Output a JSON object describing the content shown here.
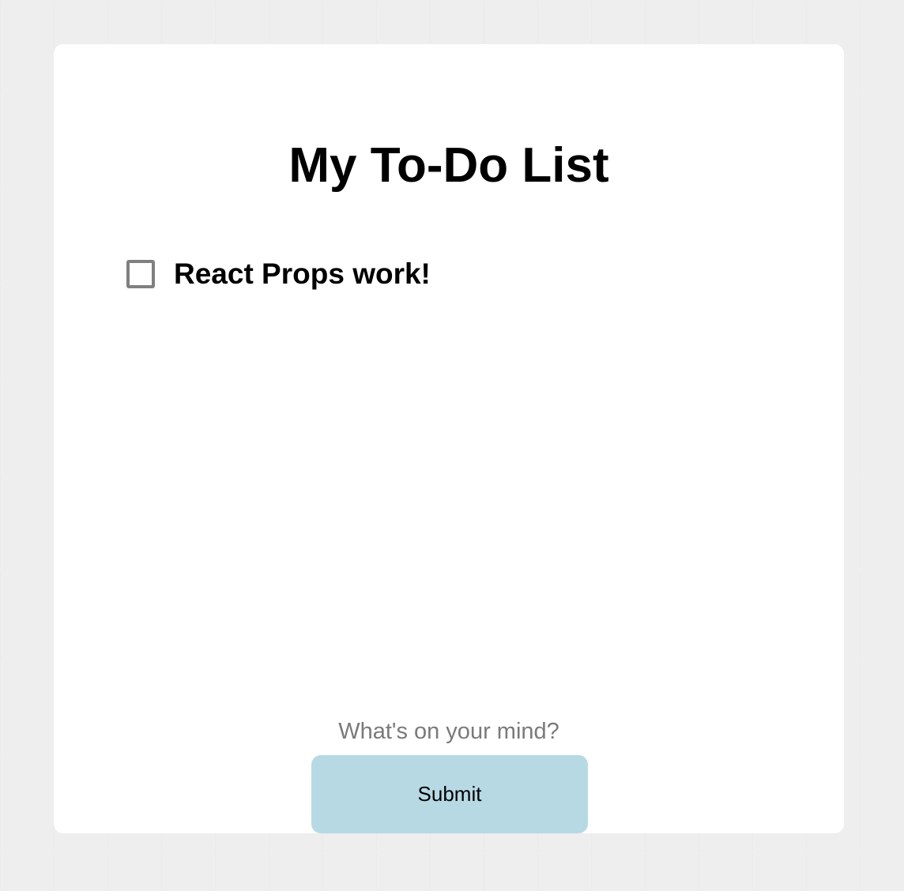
{
  "app": {
    "title": "My To-Do List"
  },
  "todos": [
    {
      "text": "React Props work!",
      "checked": false
    }
  ],
  "form": {
    "input_value": "",
    "input_placeholder": "What's on your mind?",
    "submit_label": "Submit"
  },
  "colors": {
    "page_background": "#eeeeee",
    "card_background": "#ffffff",
    "button_background": "#b7d9e4",
    "checkbox_border": "#808080",
    "placeholder_text": "#7a7a7a"
  },
  "icons": {
    "todo_checkbox": "checkbox-unchecked-icon"
  }
}
